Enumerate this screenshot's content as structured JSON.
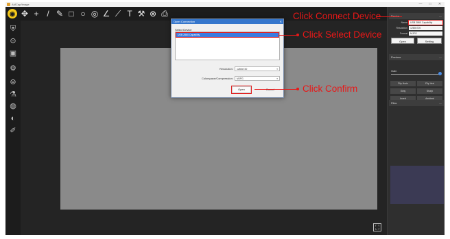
{
  "app": {
    "title": "AMCap/Image"
  },
  "window_controls": [
    "—",
    "□",
    "✕"
  ],
  "toolbar": {
    "icons": [
      {
        "name": "app-logo-icon",
        "glyph": "◉"
      },
      {
        "name": "move-icon",
        "glyph": "✥"
      },
      {
        "name": "crosshair-icon",
        "glyph": "+"
      },
      {
        "name": "line-icon",
        "glyph": "/"
      },
      {
        "name": "pen-icon",
        "glyph": "✎"
      },
      {
        "name": "rectangle-icon",
        "glyph": "□"
      },
      {
        "name": "circle-icon",
        "glyph": "○"
      },
      {
        "name": "concentric-circle-icon",
        "glyph": "◎"
      },
      {
        "name": "angle-icon",
        "glyph": "∠"
      },
      {
        "name": "polyline-icon",
        "glyph": "⟋"
      },
      {
        "name": "text-icon",
        "glyph": "T"
      },
      {
        "name": "scale-icon",
        "glyph": "⚒"
      },
      {
        "name": "clear-icon",
        "glyph": "⊗"
      },
      {
        "name": "export-icon",
        "glyph": "⎙"
      }
    ]
  },
  "leftbar": {
    "icons": [
      {
        "name": "capture-icon",
        "glyph": "⛨"
      },
      {
        "name": "camera-icon",
        "glyph": "⊙"
      },
      {
        "name": "video-icon",
        "glyph": "▣"
      },
      {
        "name": "settings-icon",
        "glyph": "⚙"
      },
      {
        "name": "measure-icon",
        "glyph": "⊜"
      },
      {
        "name": "flask-icon",
        "glyph": "⚗"
      },
      {
        "name": "target-icon",
        "glyph": "◍"
      },
      {
        "name": "drop-icon",
        "glyph": "◐"
      },
      {
        "name": "draw-icon",
        "glyph": "✐"
      }
    ]
  },
  "dialog": {
    "title": "Open Connection",
    "close": "✕",
    "select_device_label": "Select Device",
    "device_item": "USB 2860 Capability",
    "resolution_label": "Resolution:",
    "resolution_value": "1280x720",
    "compression_label": "Colorspace/Compression:",
    "compression_value": "MJPG",
    "open_button": "Open",
    "cancel_button": "Cancel"
  },
  "rightpanel": {
    "device_header": "Device",
    "name_label": "Name",
    "name_value": "USB 2860 Capability",
    "resolution_label": "Resolution",
    "resolution_value": "1280x720",
    "format_label": "Format",
    "format_value": "MJPG",
    "open_button": "Open",
    "settings_button": "Setting",
    "preview_header": "Preview",
    "gain_label": "Gain",
    "buttons": [
      "Flip Horiz",
      "Flip Vert",
      "Gray",
      "Sharp",
      "Invert",
      "Ambient"
    ],
    "filter_header": "Filter",
    "chevron": "—"
  },
  "canvas": {
    "fit_icon": "⛶"
  },
  "annotations": {
    "connect": "Click Connect Device",
    "select": "Click Select Device",
    "confirm": "Click Confirm"
  },
  "colors": {
    "annotation": "#e81818",
    "accent": "#3a7be0",
    "logo": "#f4c81a"
  }
}
